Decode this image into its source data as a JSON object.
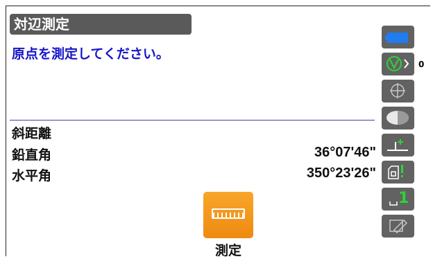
{
  "header": {
    "title": "対辺測定",
    "instruction": "原点を測定してください。"
  },
  "readings": [
    {
      "label": "斜距離",
      "value": ""
    },
    {
      "label": "鉛直角",
      "value": "36°07'46\""
    },
    {
      "label": "水平角",
      "value": "350°23'26\""
    }
  ],
  "measure": {
    "label": "測定",
    "icon": "ruler-icon"
  },
  "sidebar": {
    "target_count": "0",
    "buttons": [
      {
        "name": "battery-icon"
      },
      {
        "name": "target-prism-icon"
      },
      {
        "name": "crosshair-icon"
      },
      {
        "name": "laser-icon"
      },
      {
        "name": "tilt-correction-icon"
      },
      {
        "name": "edm-mode-icon"
      },
      {
        "name": "page-number-icon",
        "text": "1"
      },
      {
        "name": "input-mode-icon"
      }
    ]
  },
  "colors": {
    "accent": "#1515c8",
    "button_orange": "#f29a1e",
    "panel_gray": "#626262"
  }
}
